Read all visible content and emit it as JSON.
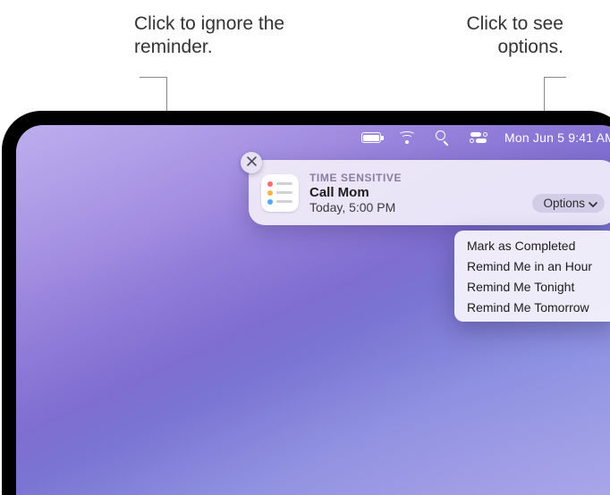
{
  "callouts": {
    "ignore": "Click to ignore the reminder.",
    "options": "Click to see options."
  },
  "menubar": {
    "clock": "Mon Jun 5  9:41 AM"
  },
  "notification": {
    "tag": "TIME SENSITIVE",
    "title": "Call Mom",
    "subtitle": "Today, 5:00 PM",
    "options_button": "Options"
  },
  "options_menu": [
    "Mark as Completed",
    "Remind Me in an Hour",
    "Remind Me Tonight",
    "Remind Me Tomorrow"
  ],
  "icons": {
    "close": "close-icon",
    "battery": "battery-icon",
    "wifi": "wifi-icon",
    "search": "search-icon",
    "control_center": "control-center-icon",
    "chevron_down": "chevron-down-icon",
    "reminders_app": "reminders-app-icon"
  }
}
